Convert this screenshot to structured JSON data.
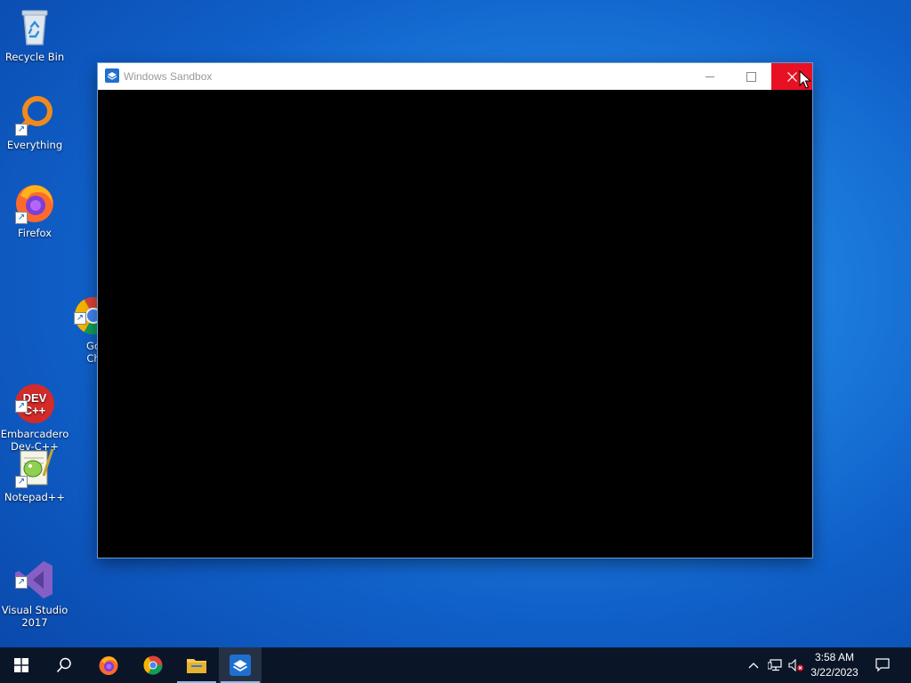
{
  "desktop": {
    "icons": [
      {
        "label": "Recycle Bin",
        "icon": "recycle-bin-icon"
      },
      {
        "label": "Everything",
        "icon": "everything-search-icon"
      },
      {
        "label": "Firefox",
        "icon": "firefox-icon"
      },
      {
        "label": "Go\nCh",
        "icon": "chrome-icon"
      },
      {
        "label": "Embarcadero\nDev-C++",
        "icon": "devcpp-icon"
      },
      {
        "label": "Notepad++",
        "icon": "notepadpp-icon"
      },
      {
        "label": "Visual Studio\n2017",
        "icon": "visual-studio-icon"
      }
    ]
  },
  "window": {
    "title": "Windows Sandbox",
    "minimize_glyph": "—",
    "maximize_glyph": "☐",
    "close_glyph": "✕"
  },
  "taskbar": {
    "clock_time": "3:58 AM",
    "clock_date": "3/22/2023"
  },
  "colors": {
    "close_hover": "#e81123",
    "taskbar_bg": "#0a1628",
    "accent": "#1e7fe0"
  }
}
